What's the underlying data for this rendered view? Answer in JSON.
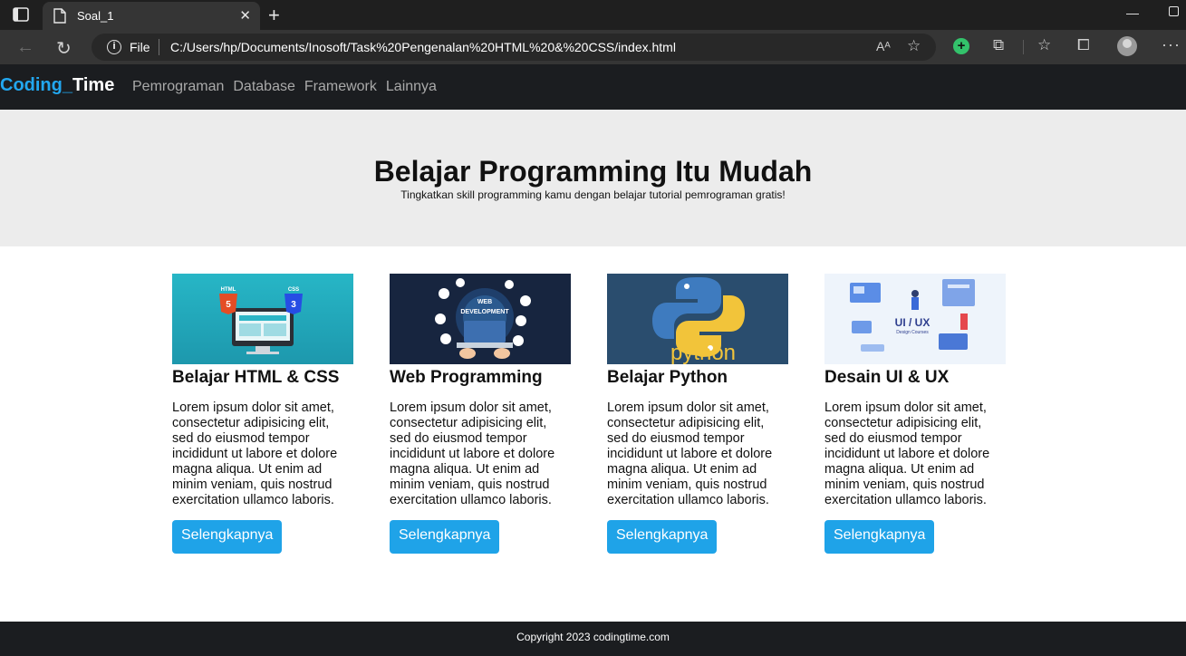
{
  "browser": {
    "tab_title": "Soal_1",
    "close_glyph": "✕",
    "new_tab_glyph": "+",
    "scheme": "File",
    "url": "C:/Users/hp/Documents/Inosoft/Task%20Pengenalan%20HTML%20&%20CSS/index.html",
    "read_aloud": "Aᴬ",
    "icons": [
      "tab-actions-icon",
      "document-icon",
      "back-icon",
      "refresh-icon",
      "info-icon",
      "read-aloud-icon",
      "favorite-add-icon",
      "copilot-icon",
      "extensions-icon",
      "favorites-icon",
      "collections-icon",
      "profile-icon",
      "more-icon",
      "minimize-icon",
      "restore-icon"
    ]
  },
  "site": {
    "brand_part1": "Coding_",
    "brand_part2": "Time",
    "brand_color": "#22a7f0",
    "menu": [
      "Pemrograman",
      "Database",
      "Framework",
      "Lainnya"
    ],
    "hero_title": "Belajar Programming Itu Mudah",
    "hero_subtitle": "Tingkatkan skill programming kamu dengan belajar tutorial pemrograman gratis!",
    "cards": [
      {
        "title": "Belajar HTML & CSS",
        "body": "Lorem ipsum dolor sit amet, consectetur adipisicing elit, sed do eiusmod tempor incididunt ut labore et dolore magna aliqua. Ut enim ad minim veniam, quis nostrud exercitation ullamco laboris.",
        "button": "Selengkapnya",
        "image_text": [
          "HTML",
          "CSS"
        ]
      },
      {
        "title": "Web Programming",
        "body": "Lorem ipsum dolor sit amet, consectetur adipisicing elit, sed do eiusmod tempor incididunt ut labore et dolore magna aliqua. Ut enim ad minim veniam, quis nostrud exercitation ullamco laboris.",
        "button": "Selengkapnya",
        "image_text": [
          "WEB",
          "DEVELOPMENT"
        ]
      },
      {
        "title": "Belajar Python",
        "body": "Lorem ipsum dolor sit amet, consectetur adipisicing elit, sed do eiusmod tempor incididunt ut labore et dolore magna aliqua. Ut enim ad minim veniam, quis nostrud exercitation ullamco laboris.",
        "button": "Selengkapnya",
        "image_text": [
          "python"
        ]
      },
      {
        "title": "Desain UI & UX",
        "body": "Lorem ipsum dolor sit amet, consectetur adipisicing elit, sed do eiusmod tempor incididunt ut labore et dolore magna aliqua. Ut enim ad minim veniam, quis nostrud exercitation ullamco laboris.",
        "button": "Selengkapnya",
        "image_text": [
          "UI / UX",
          "Design Courses"
        ]
      }
    ],
    "footer": "Copyright 2023 codingtime.com",
    "button_color": "#1fa3e8"
  }
}
